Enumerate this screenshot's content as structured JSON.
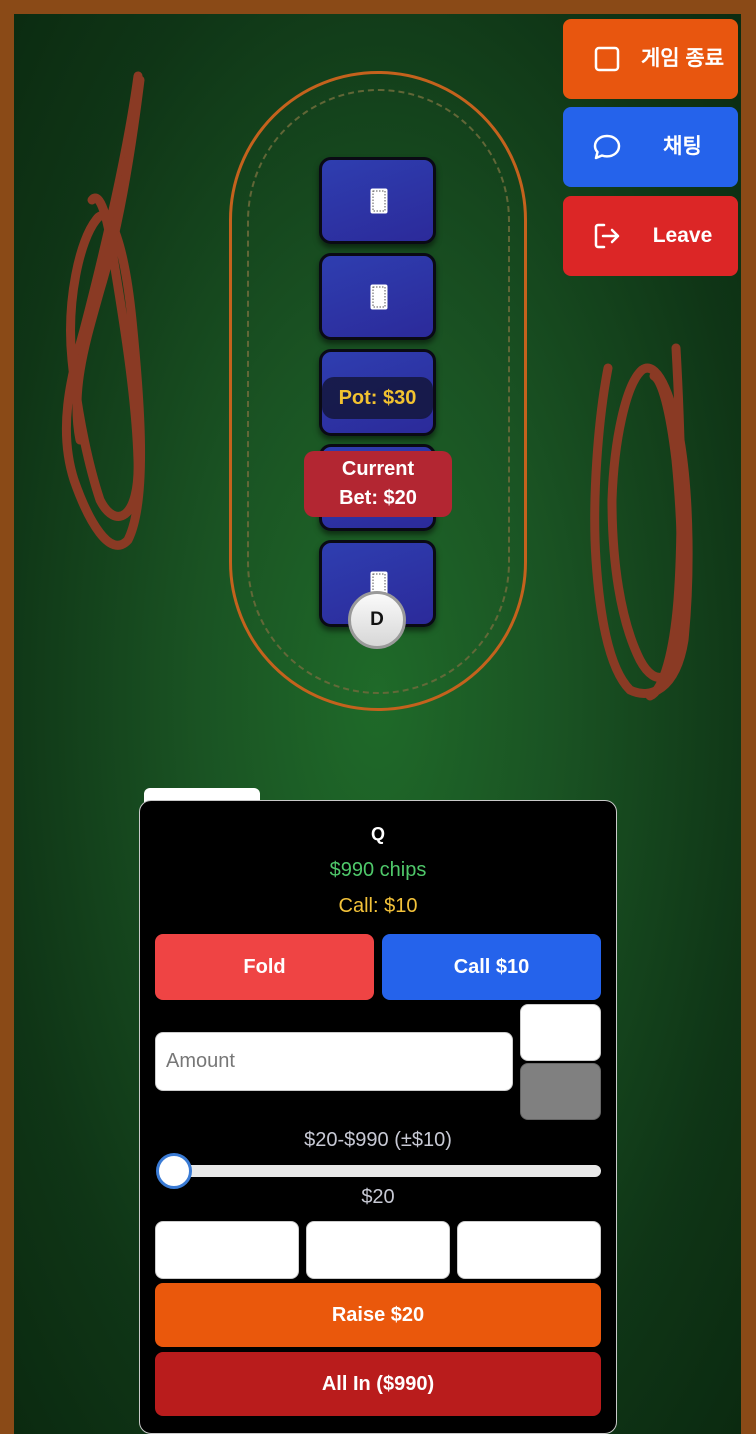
{
  "header": {
    "end_game_label": "게임 종료",
    "chat_label": "채팅",
    "leave_label": "Leave"
  },
  "table": {
    "pot_label": "Pot: $30",
    "current_bet_line1": "Current",
    "current_bet_line2": "Bet: $20",
    "dealer_label": "D"
  },
  "player": {
    "name": "Q",
    "chips": "$990 chips",
    "call_info": "Call: $10"
  },
  "actions": {
    "fold_label": "Fold",
    "call_label": "Call $10",
    "amount_placeholder": "Amount",
    "range_label": "$20-$990 (±$10)",
    "slider_value": "$20",
    "slider_level": 0,
    "raise_label": "Raise $20",
    "all_in_label": "All In ($990)"
  },
  "colors": {
    "end_game": "#e8560f",
    "chat": "#2563eb",
    "leave": "#dc2626",
    "fold": "#ef4444",
    "call": "#2563eb",
    "raise": "#ea580c",
    "all_in": "#b91c1c",
    "pot_text": "#f2c230",
    "chips_text": "#4fc86a"
  },
  "icons": {
    "end_game": "square-icon",
    "chat": "chat-bubble-icon",
    "leave": "logout-icon",
    "card_back": "card-back-icon"
  }
}
